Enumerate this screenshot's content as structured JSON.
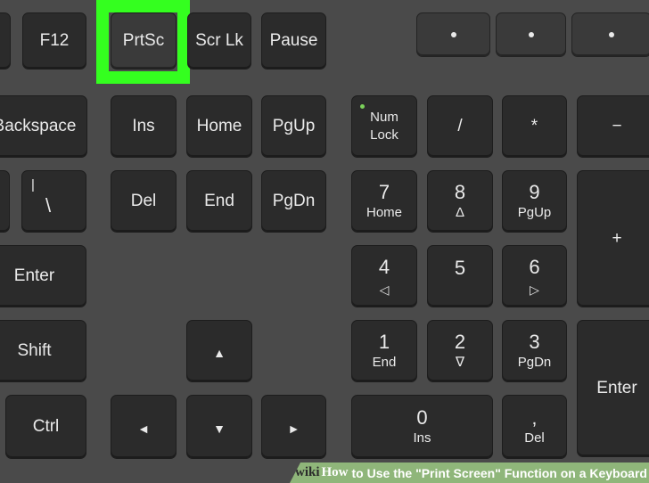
{
  "keys": {
    "f12": "F12",
    "prtsc": "PrtSc",
    "scrlk": "Scr Lk",
    "pause": "Pause",
    "backspace": "Backspace",
    "ins": "Ins",
    "home": "Home",
    "pgup": "PgUp",
    "del": "Del",
    "end": "End",
    "pgdn": "PgDn",
    "backslash_top": "|",
    "backslash": "\\",
    "enter": "Enter",
    "shift": "Shift",
    "ctrl": "Ctrl",
    "arrow_up": "▲",
    "arrow_left": "◄",
    "arrow_down": "▼",
    "arrow_right": "►"
  },
  "numpad": {
    "numlock_1": "Num",
    "numlock_2": "Lock",
    "divide": "/",
    "multiply": "*",
    "minus": "−",
    "plus": "+",
    "enter": "Enter",
    "k7": "7",
    "k7_sub": "Home",
    "k8": "8",
    "k8_sub": "Δ",
    "k9": "9",
    "k9_sub": "PgUp",
    "k4": "4",
    "k4_sub": "◁",
    "k5": "5",
    "k6": "6",
    "k6_sub": "▷",
    "k1": "1",
    "k1_sub": "End",
    "k2": "2",
    "k2_sub": "∇",
    "k3": "3",
    "k3_sub": "PgDn",
    "k0": "0",
    "k0_sub": "Ins",
    "kdot": "‚",
    "kdot_sub": "Del"
  },
  "caption": {
    "brand": "wiki",
    "how": "How",
    "text": "to Use the \"Print Screen\" Function on a Keyboard"
  },
  "colors": {
    "highlight": "#34ff1f",
    "banner": "#8fb67a",
    "background": "#4a4a4a",
    "key": "#2b2b2b"
  },
  "highlighted_key": "PrtSc"
}
